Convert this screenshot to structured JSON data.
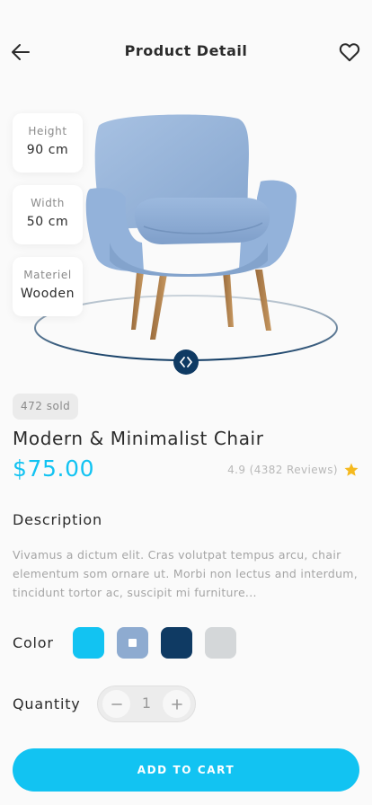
{
  "header": {
    "title": "Product Detail",
    "back_icon": "arrow-left-icon",
    "favorite_icon": "heart-outline-icon"
  },
  "specs": [
    {
      "label": "Height",
      "value": "90 cm"
    },
    {
      "label": "Width",
      "value": "50 cm"
    },
    {
      "label": "Materiel",
      "value": "Wooden"
    }
  ],
  "product": {
    "image_icon": "armchair-image",
    "rotate_icon": "rotate-left-right-icon",
    "sold": "472 sold",
    "name": "Modern & Minimalist Chair",
    "price": "$75.00",
    "rating_text": "4.9 (4382 Reviews)",
    "rating_icon": "star-icon"
  },
  "description": {
    "title": "Description",
    "text": "Vivamus a dictum elit. Cras volutpat tempus arcu, chair elementum som ornare ut. Morbi non lectus and interdum, tincidunt tortor ac, suscipit mi furniture..."
  },
  "color": {
    "title": "Color",
    "options": [
      {
        "hex": "#12c3f2",
        "selected": false
      },
      {
        "hex": "#8eabd0",
        "selected": true
      },
      {
        "hex": "#0f3a63",
        "selected": false
      },
      {
        "hex": "#d4d7d9",
        "selected": false
      }
    ]
  },
  "quantity": {
    "title": "Quantity",
    "value": "1",
    "minus_icon": "minus-icon",
    "plus_icon": "plus-icon"
  },
  "cta": {
    "label": "ADD TO CART"
  },
  "theme": {
    "accent": "#12c3f2",
    "navy": "#0f3a63",
    "background": "#fafafa"
  }
}
